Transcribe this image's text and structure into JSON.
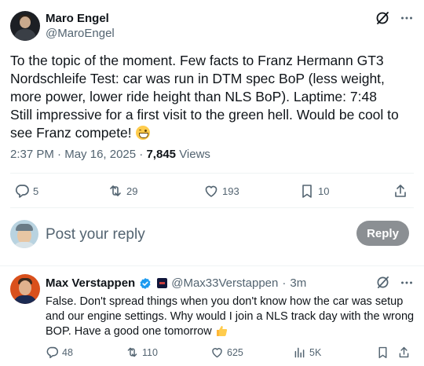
{
  "main_tweet": {
    "author_name": "Maro Engel",
    "author_handle": "@MaroEngel",
    "text": "To the topic of the moment. Few facts to Franz Hermann GT3 Nordschleife Test: car was run in DTM spec BoP (less weight, more power, lower ride height than NLS BoP). Laptime: 7:48\nStill impressive for a first visit to the green hell. Would be cool to see Franz compete! ",
    "time": "2:37 PM",
    "date": "May 16, 2025",
    "views_count": "7,845",
    "views_label": "Views",
    "replies": "5",
    "reposts": "29",
    "likes": "193",
    "bookmarks": "10"
  },
  "compose": {
    "placeholder": "Post your reply",
    "button_label": "Reply"
  },
  "reply_tweet": {
    "author_name": "Max Verstappen",
    "author_handle": "@Max33Verstappen",
    "separator": "·",
    "time_ago": "3m",
    "text": "False. Don't spread things when you don't know how the car was setup and our engine settings. Why would I join a NLS track day with the wrong BOP. Have a good one tomorrow ",
    "replies": "48",
    "reposts": "110",
    "likes": "625",
    "views": "5K"
  },
  "colors": {
    "text": "#0f1419",
    "muted": "#536471",
    "divider": "#eff3f4",
    "verified_blue": "#1d9bf0",
    "reply_button_bg": "#8b8f93"
  }
}
